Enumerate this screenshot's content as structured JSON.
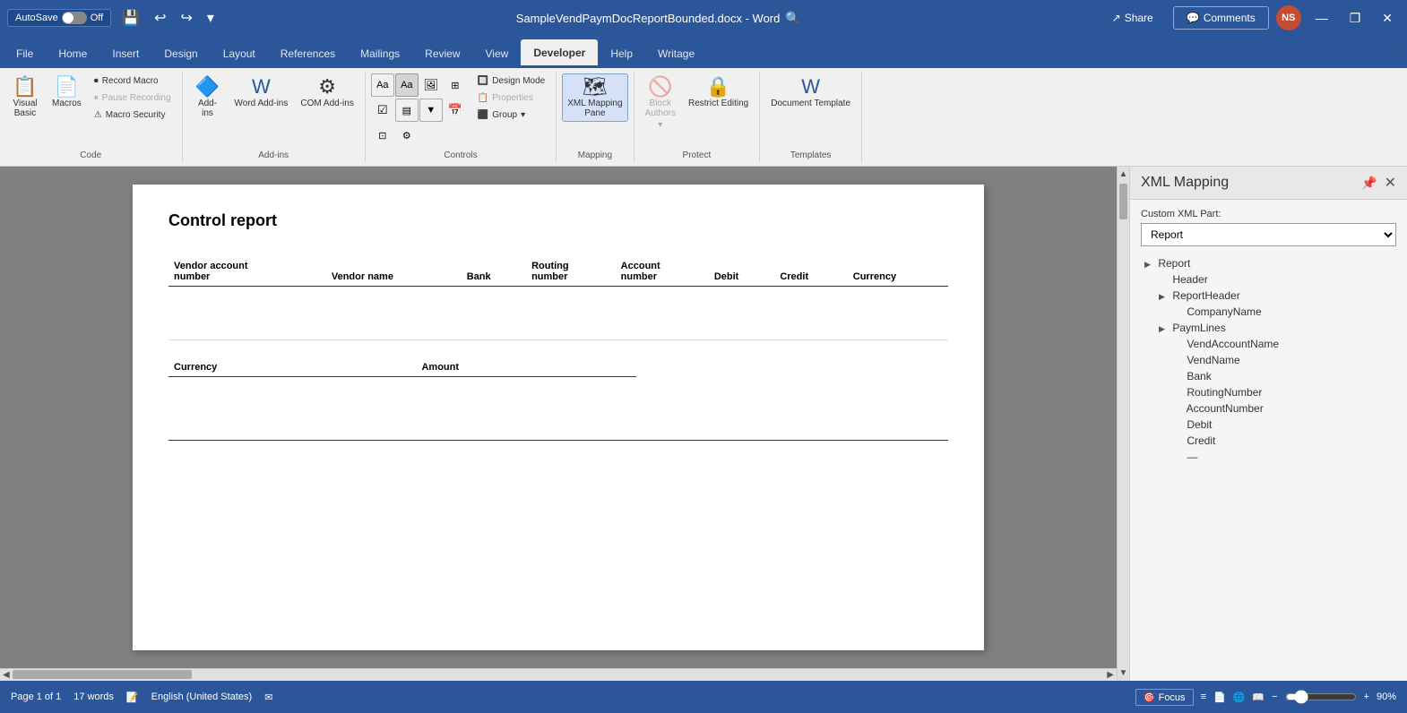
{
  "titleBar": {
    "autosave_label": "AutoSave",
    "autosave_state": "Off",
    "title": "SampleVendPaymDocReportBounded.docx - Word",
    "search_placeholder": "Search",
    "user_initials": "NS",
    "minimize": "—",
    "restore": "❐",
    "close": "✕"
  },
  "ribbon": {
    "tabs": [
      "File",
      "Home",
      "Insert",
      "Design",
      "Layout",
      "References",
      "Mailings",
      "Review",
      "View",
      "Developer",
      "Help",
      "Writage"
    ],
    "active_tab": "Developer",
    "share_label": "Share",
    "comments_label": "Comments",
    "groups": {
      "code": {
        "label": "Code",
        "visual_basic_label": "Visual\nBasic",
        "macros_label": "Macros",
        "record_macro_label": "Record Macro",
        "pause_recording_label": "Pause Recording",
        "macro_security_label": "Macro Security"
      },
      "addins": {
        "label": "Add-ins",
        "addins_label": "Add-\nins",
        "word_addins_label": "Word\nAdd-ins",
        "com_addins_label": "COM\nAdd-ins"
      },
      "controls": {
        "label": "Controls",
        "design_mode_label": "Design Mode",
        "properties_label": "Properties",
        "group_label": "Group"
      },
      "mapping": {
        "label": "Mapping",
        "xml_mapping_pane_label": "XML Mapping\nPane"
      },
      "protect": {
        "label": "Protect",
        "block_authors_label": "Block\nAuthors",
        "restrict_editing_label": "Restrict\nEditing"
      },
      "templates": {
        "label": "Templates",
        "document_template_label": "Document\nTemplate"
      }
    }
  },
  "document": {
    "title": "Control report",
    "table1": {
      "headers": [
        "Vendor account\nnumber",
        "Vendor name",
        "Bank",
        "Routing\nnumber",
        "Account\nnumber",
        "Debit",
        "Credit",
        "Currency"
      ],
      "rows": []
    },
    "table2": {
      "headers": [
        "Currency",
        "Amount"
      ],
      "rows": []
    }
  },
  "xmlPanel": {
    "title": "XML Mapping",
    "close_label": "✕",
    "custom_xml_part_label": "Custom XML Part:",
    "select_value": "Report",
    "tree": [
      {
        "label": "Report",
        "indent": 0,
        "expanded": true,
        "has_triangle": true
      },
      {
        "label": "Header",
        "indent": 1,
        "expanded": false,
        "has_triangle": false
      },
      {
        "label": "ReportHeader",
        "indent": 1,
        "expanded": true,
        "has_triangle": true
      },
      {
        "label": "CompanyName",
        "indent": 2,
        "expanded": false,
        "has_triangle": false
      },
      {
        "label": "PaymLines",
        "indent": 1,
        "expanded": true,
        "has_triangle": true
      },
      {
        "label": "VendAccountName",
        "indent": 2,
        "expanded": false,
        "has_triangle": false
      },
      {
        "label": "VendName",
        "indent": 2,
        "expanded": false,
        "has_triangle": false
      },
      {
        "label": "Bank",
        "indent": 2,
        "expanded": false,
        "has_triangle": false
      },
      {
        "label": "RoutingNumber",
        "indent": 2,
        "expanded": false,
        "has_triangle": false
      },
      {
        "label": "AccountNumber",
        "indent": 2,
        "expanded": false,
        "has_triangle": false
      },
      {
        "label": "Debit",
        "indent": 2,
        "expanded": false,
        "has_triangle": false
      },
      {
        "label": "Credit",
        "indent": 2,
        "expanded": false,
        "has_triangle": false
      }
    ]
  },
  "statusBar": {
    "page_info": "Page 1 of 1",
    "word_count": "17 words",
    "language": "English (United States)",
    "focus_label": "Focus",
    "zoom_percent": "90%"
  }
}
